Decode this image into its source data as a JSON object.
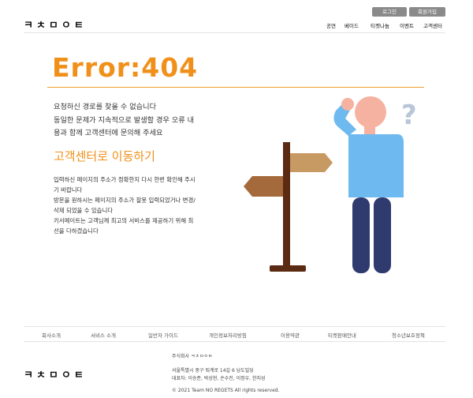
{
  "header": {
    "logo_text": "ㅋㅊㅁㅇㅌ",
    "login_button": "로그인",
    "signup_button": "회원가입",
    "nav": [
      "공연",
      "베이드",
      "티켓나눔",
      "이벤트",
      "고객센터"
    ]
  },
  "error": {
    "title": "Error:404",
    "message_lines": [
      "요청하신 경로를 찾을 수 없습니다",
      "동일한 문제가 지속적으로 발생할 경우 오류 내",
      "용과 함께 고객센터에 문의해 주세요"
    ],
    "link_label": "고객센터로 이동하기",
    "detail_lines": [
      "입력하신 페이지의 주소가 정확한지 다시 한번 확인해 주시",
      "기 바랍니다",
      "방문을 원하시는 페이지의 주소가 잘못 입력되었거나 변경/",
      "삭제 되었을 수 있습니다",
      "키서메이트는 고객님께 최고의 서비스를 제공하기 위해 최",
      "선을 다하겠습니다"
    ]
  },
  "illustration": {
    "question_mark": "?"
  },
  "footer": {
    "links": [
      "회사소개",
      "서비스 소개",
      "일반자 가이드",
      "개인정보처리방침",
      "이용약관",
      "티켓판매안내",
      "청소년보호정책"
    ],
    "logo_text": "ㅋㅊㅁㅇㅌ",
    "info_lines": [
      "주식회사 ㅋㅊㅁㅇㅌ",
      "서울특별시 중구 퇴계로 14길 6 남도빌딩",
      "대표자: 이승준, 박상현, 손수진, 이정우, 한지성"
    ],
    "copyright": "© 2021 Team NO REGETS All rights reserved."
  },
  "colors": {
    "orange": "#f0901a",
    "post": "#5a2a12",
    "skin": "#f6b2a0",
    "shirt": "#6eb9ef",
    "pants": "#2f3a6e"
  }
}
